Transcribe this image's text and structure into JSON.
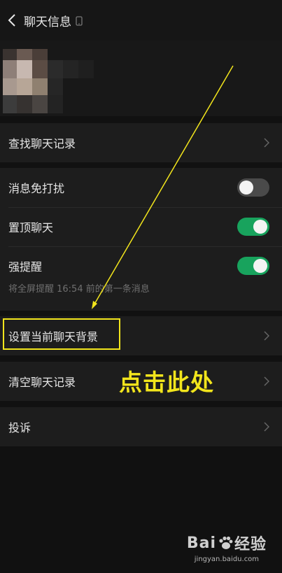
{
  "header": {
    "title": "聊天信息"
  },
  "search_history": {
    "label": "查找聊天记录"
  },
  "settings": {
    "mute": {
      "label": "消息免打扰",
      "enabled": false
    },
    "pin": {
      "label": "置顶聊天",
      "enabled": true
    },
    "strong_alert": {
      "label": "强提醒",
      "enabled": true
    },
    "strong_alert_hint": "将全屏提醒 16:54 前的第一条消息"
  },
  "set_background": {
    "label": "设置当前聊天背景"
  },
  "clear_history": {
    "label": "清空聊天记录"
  },
  "complaint": {
    "label": "投诉"
  },
  "annotation": {
    "text": "点击此处"
  },
  "watermark": {
    "brand_left": "Bai",
    "brand_right": "经验",
    "url": "jingyan.baidu.com"
  },
  "colors": {
    "toggle_on": "#18a35d",
    "toggle_off": "#4a4a4a",
    "annotation": "#f2e51c",
    "background": "#111111",
    "section": "#1d1d1d"
  }
}
